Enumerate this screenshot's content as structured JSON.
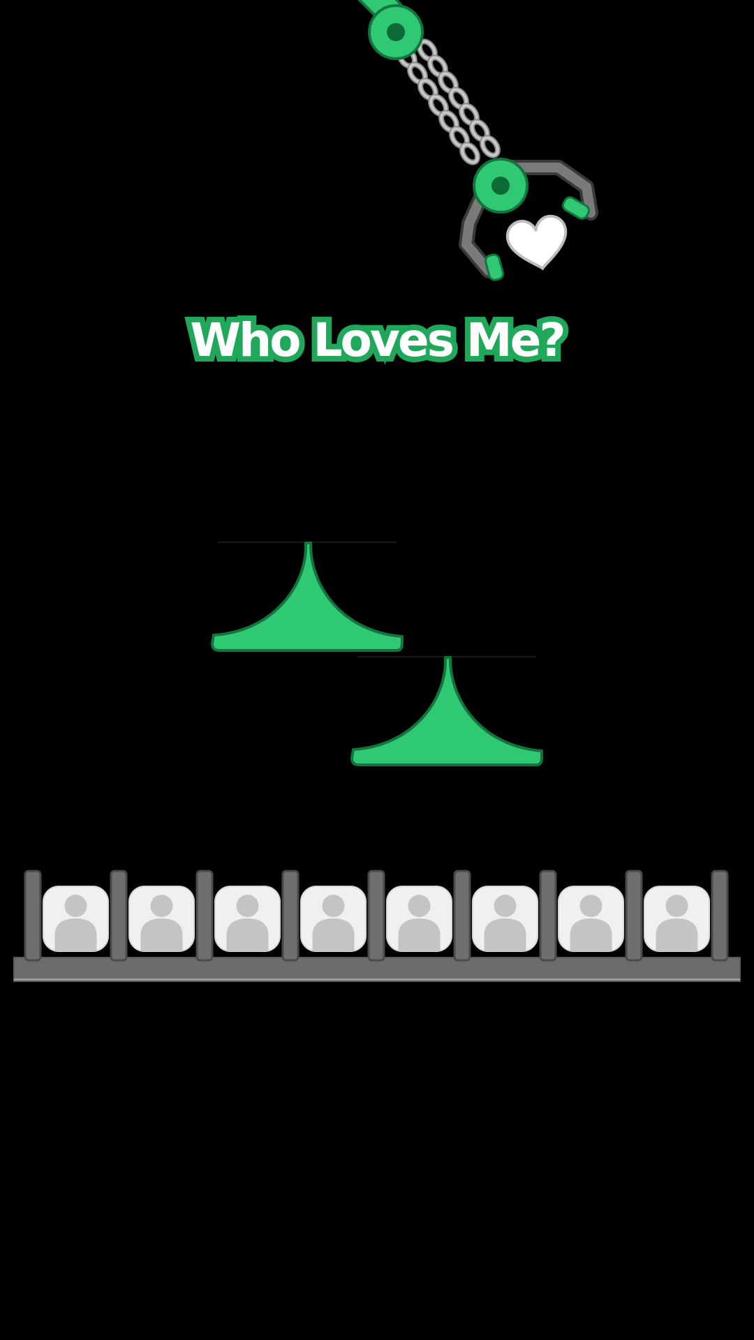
{
  "title": "Who Loves Me?",
  "colors": {
    "accent": "#2ec972",
    "accent_dark": "#12753d",
    "rail": "#707070",
    "tile": "#f0f0f0",
    "silhouette": "#c4c4c4",
    "background": "#000000"
  },
  "claw": {
    "icon": "claw-crane-icon",
    "holding": "heart-icon"
  },
  "slots": [
    {
      "icon": "person-avatar-icon"
    },
    {
      "icon": "person-avatar-icon"
    },
    {
      "icon": "person-avatar-icon"
    },
    {
      "icon": "person-avatar-icon"
    },
    {
      "icon": "person-avatar-icon"
    },
    {
      "icon": "person-avatar-icon"
    },
    {
      "icon": "person-avatar-icon"
    },
    {
      "icon": "person-avatar-icon"
    }
  ]
}
